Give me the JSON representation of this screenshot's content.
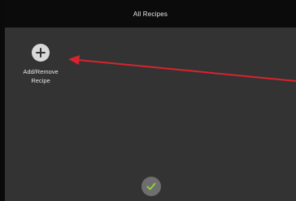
{
  "header": {
    "title": "All Recipes"
  },
  "actions": {
    "add_remove_label_line1": "Add/Remove",
    "add_remove_label_line2": "Recipe",
    "add_icon": "plus-icon",
    "confirm_icon": "checkmark-icon"
  },
  "colors": {
    "background": "#333333",
    "title_bar": "#0b0b0b",
    "confirm_check": "#8ed23f",
    "annotation_arrow": "#d9232e"
  }
}
